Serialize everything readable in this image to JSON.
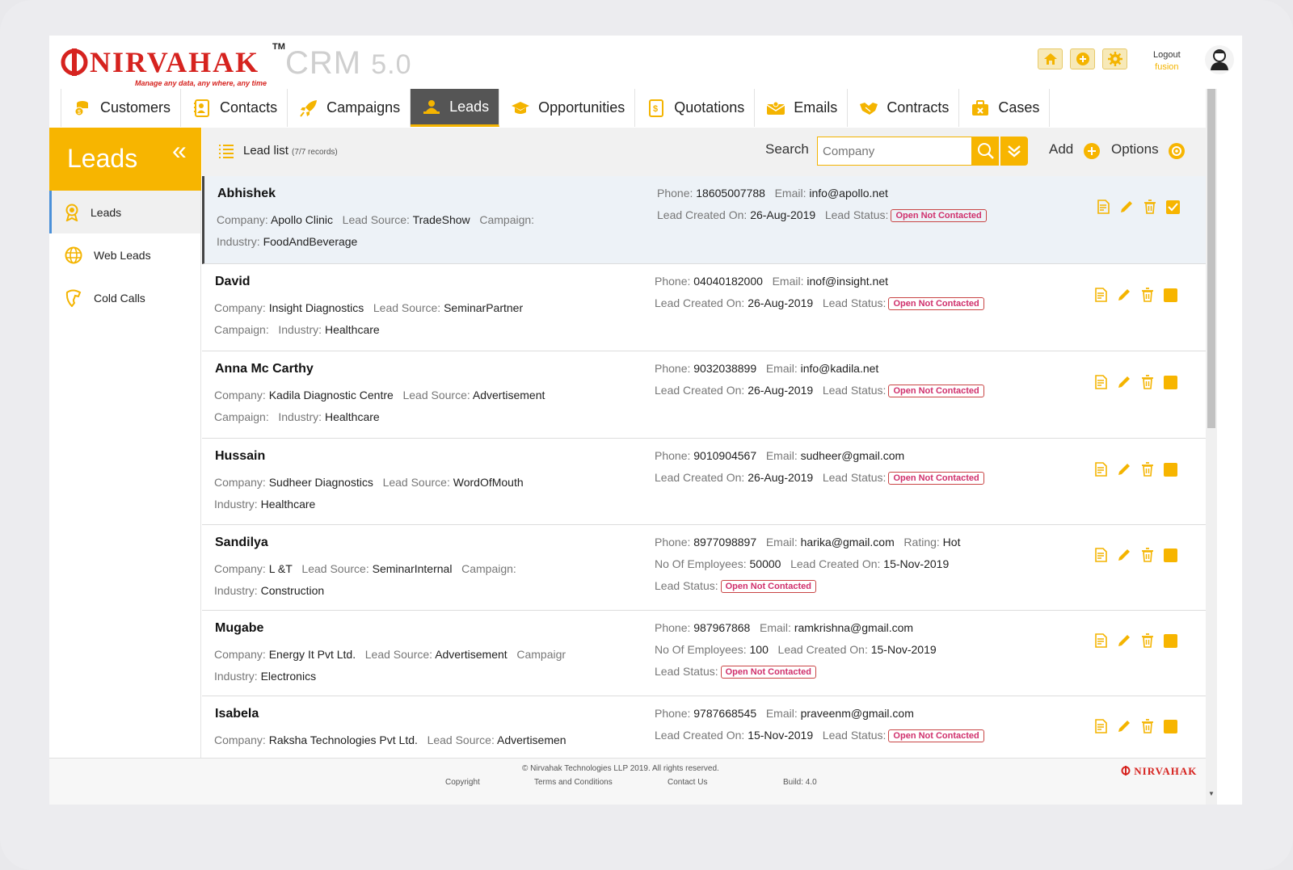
{
  "header": {
    "logo_text": "NIRVAHAK",
    "logo_tm": "TM",
    "tagline": "Manage any data, any where, any time",
    "product": "CRM",
    "version": "5.0",
    "logout_label": "Logout",
    "username": "fusion",
    "icons": [
      "home-icon",
      "add-icon",
      "settings-icon"
    ]
  },
  "tabs": [
    {
      "label": "Customers",
      "icon": "customers-icon",
      "active": false
    },
    {
      "label": "Contacts",
      "icon": "contacts-icon",
      "active": false
    },
    {
      "label": "Campaigns",
      "icon": "rocket-icon",
      "active": false
    },
    {
      "label": "Leads",
      "icon": "leads-icon",
      "active": true
    },
    {
      "label": "Opportunities",
      "icon": "graduation-cap-icon",
      "active": false
    },
    {
      "label": "Quotations",
      "icon": "document-dollar-icon",
      "active": false
    },
    {
      "label": "Emails",
      "icon": "envelope-icon",
      "active": false
    },
    {
      "label": "Contracts",
      "icon": "handshake-icon",
      "active": false
    },
    {
      "label": "Cases",
      "icon": "briefcase-icon",
      "active": false
    }
  ],
  "sidebar": {
    "title": "Leads",
    "collapse_glyph": "«",
    "items": [
      {
        "label": "Leads",
        "icon": "award-icon",
        "active": true
      },
      {
        "label": "Web Leads",
        "icon": "globe-icon",
        "active": false
      },
      {
        "label": "Cold Calls",
        "icon": "phone-icon",
        "active": false
      }
    ]
  },
  "listbar": {
    "title": "Lead list",
    "count": "(7/7 records)",
    "search_label": "Search",
    "search_placeholder": "Company",
    "add_label": "Add",
    "options_label": "Options"
  },
  "labels": {
    "company": "Company:",
    "lead_source": "Lead Source:",
    "campaign": "Campaign:",
    "industry": "Industry:",
    "phone": "Phone:",
    "email": "Email:",
    "lead_created_on": "Lead Created On:",
    "lead_status": "Lead Status:",
    "rating": "Rating:",
    "no_of_employees": "No Of Employees:"
  },
  "leads": [
    {
      "name": "Abhishek",
      "company": "Apollo Clinic",
      "lead_source": "TradeShow",
      "industry": "FoodAndBeverage",
      "phone": "18605007788",
      "email": "info@apollo.net",
      "created": "26-Aug-2019",
      "status": "Open Not Contacted",
      "checked": true
    },
    {
      "name": "David",
      "company": "Insight Diagnostics",
      "lead_source": "SeminarPartner",
      "industry": "Healthcare",
      "phone": "04040182000",
      "email": "inof@insight.net",
      "created": "26-Aug-2019",
      "status": "Open Not Contacted",
      "checked": false
    },
    {
      "name": "Anna Mc Carthy",
      "company": "Kadila Diagnostic Centre",
      "lead_source": "Advertisement",
      "industry": "Healthcare",
      "phone": "9032038899",
      "email": "info@kadila.net",
      "created": "26-Aug-2019",
      "status": "Open Not Contacted",
      "checked": false
    },
    {
      "name": "Hussain",
      "company": "Sudheer Diagnostics",
      "lead_source": "WordOfMouth",
      "industry": "Healthcare",
      "phone": "9010904567",
      "email": "sudheer@gmail.com",
      "created": "26-Aug-2019",
      "status": "Open Not Contacted",
      "checked": false
    },
    {
      "name": "Sandilya",
      "company": "L &T",
      "lead_source": "SeminarInternal",
      "industry": "Construction",
      "phone": "8977098897",
      "email": "harika@gmail.com",
      "rating": "Hot",
      "employees": "50000",
      "created": "15-Nov-2019",
      "status": "Open Not Contacted",
      "checked": false
    },
    {
      "name": "Mugabe",
      "company": "Energy It Pvt Ltd.",
      "lead_source": "Advertisement",
      "campaign_trunc": "Campaigr",
      "industry": "Electronics",
      "phone": "987967868",
      "email": "ramkrishna@gmail.com",
      "employees": "100",
      "created": "15-Nov-2019",
      "status": "Open Not Contacted",
      "checked": false
    },
    {
      "name": "Isabela",
      "company": "Raksha Technologies Pvt Ltd.",
      "lead_source": "Advertisemen",
      "phone": "9787668545",
      "email": "praveenm@gmail.com",
      "created": "15-Nov-2019",
      "status": "Open Not Contacted",
      "checked": false
    }
  ],
  "footer": {
    "copyright": "© Nirvahak Technologies LLP 2019. All rights reserved.",
    "links": [
      "Copyright",
      "Terms and Conditions",
      "Contact Us",
      "Build: 4.0"
    ],
    "logo": "NIRVAHAK"
  },
  "colors": {
    "accent": "#f7b500",
    "brand_red": "#d6231f",
    "status_pink": "#d0306c",
    "active_tab": "#555555"
  }
}
